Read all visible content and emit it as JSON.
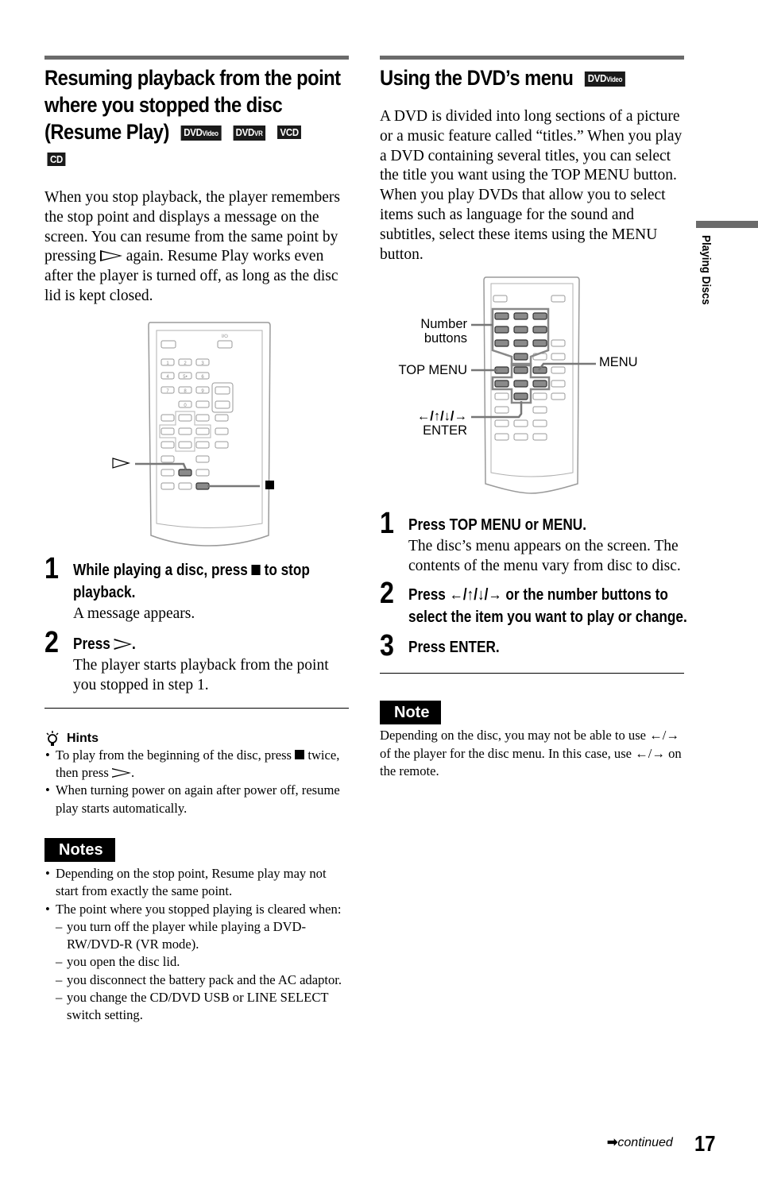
{
  "left": {
    "title": "Resuming playback from the point where you stopped the disc (Resume Play)",
    "badges": [
      {
        "main": "DVD",
        "sub": "Video"
      },
      {
        "main": "DVD",
        "sub": "VR"
      },
      {
        "main": "VCD",
        "sub": ""
      },
      {
        "main": "CD",
        "sub": ""
      }
    ],
    "intro_part1": "When you stop playback, the player remembers the stop point and displays a message on the screen. You can resume from the same point by pressing",
    "intro_part2": "again. Resume Play works even after the player is turned off, as long as the disc lid is kept closed.",
    "figure": {
      "play_callout": "play-icon",
      "stop_callout": "stop-icon",
      "power_label": "I/⏻",
      "number_keys": [
        "1",
        "2",
        "3",
        "4",
        "5•",
        "6",
        "7",
        "8",
        "9",
        "0"
      ]
    },
    "steps": [
      {
        "number": "1",
        "heading_part1": "While playing a disc, press",
        "heading_part2": "to stop playback.",
        "body": "A message appears."
      },
      {
        "number": "2",
        "heading_part1": "Press",
        "heading_part2": ".",
        "body": "The player starts playback from the point you stopped in step 1."
      }
    ],
    "hints": {
      "title": "Hints",
      "items": [
        {
          "part1": "To play from the beginning of the disc, press",
          "part2": "twice, then press",
          "part3": "."
        },
        {
          "text": "When turning power on again after power off, resume play starts automatically."
        }
      ]
    },
    "notes": {
      "title": "Notes",
      "items": [
        "Depending on the stop point, Resume play may not start from exactly the same point.",
        "The point where you stopped playing is cleared when:"
      ],
      "subitems": [
        "you turn off the player while playing a DVD-RW/DVD-R (VR mode).",
        "you open the disc lid.",
        "you disconnect the battery pack and the AC adaptor.",
        "you change the CD/DVD USB or LINE SELECT switch setting."
      ]
    }
  },
  "right": {
    "title": "Using the DVD’s menu",
    "badge": {
      "main": "DVD",
      "sub": "Video"
    },
    "intro1": "A DVD is divided into long sections of a picture or a music feature called “titles.” When you play a DVD containing several titles, you can select the title you want using the TOP MENU button.",
    "intro2": "When you play DVDs that allow you to select items such as language for the sound and subtitles, select these items using the MENU button.",
    "figure": {
      "labels": {
        "number_buttons_1": "Number",
        "number_buttons_2": "buttons",
        "top_menu": "TOP MENU",
        "menu": "MENU",
        "arrows": "←/↑/↓/→",
        "enter": "ENTER"
      }
    },
    "steps": [
      {
        "number": "1",
        "heading": "Press TOP MENU or MENU.",
        "body": "The disc’s menu appears on the screen. The contents of the menu vary from disc to disc."
      },
      {
        "number": "2",
        "heading": "Press ←/↑/↓/→ or the number buttons to select the item you want to play or change.",
        "body": ""
      },
      {
        "number": "3",
        "heading": "Press ENTER.",
        "body": ""
      }
    ],
    "note": {
      "title": "Note",
      "text": "Depending on the disc, you may not be able to use ←/→ of the player for the disc menu. In this case, use ←/→ on the remote."
    }
  },
  "side_tab": {
    "label": "Playing Discs"
  },
  "footer": {
    "continued": "continued",
    "page_number": "17"
  },
  "colors": {
    "rule": "#6b6b6b",
    "badge_bg": "#1a1a1a",
    "note_bg": "#000000",
    "highlight_button": "#8a8a8a",
    "remote_outline": "#9a9a9a"
  }
}
